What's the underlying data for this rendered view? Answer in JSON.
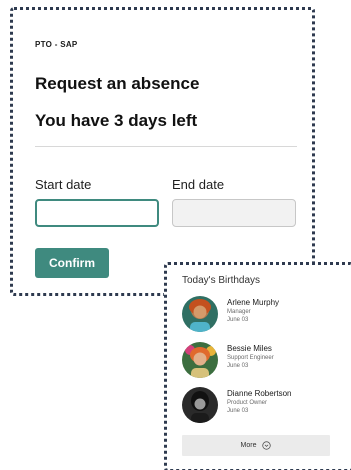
{
  "pto": {
    "tag": "PTO - SAP",
    "title": "Request an absence",
    "subtitle": "You have 3 days left",
    "start_label": "Start date",
    "end_label": "End date",
    "start_value": "",
    "end_value": "",
    "confirm_label": "Confirm",
    "accent_color": "#3f8a7f"
  },
  "birthdays": {
    "title": "Today's Birthdays",
    "people": [
      {
        "name": "Arlene Murphy",
        "role": "Manager",
        "date": "June 03",
        "avatar": "avatar-photo"
      },
      {
        "name": "Bessie Miles",
        "role": "Support Engineer",
        "date": "June 03",
        "avatar": "avatar-photo"
      },
      {
        "name": "Dianne Robertson",
        "role": "Product Owner",
        "date": "June 03",
        "avatar": "avatar-photo"
      }
    ],
    "more_label": "More",
    "more_icon": "chevron-down-circle-icon"
  }
}
